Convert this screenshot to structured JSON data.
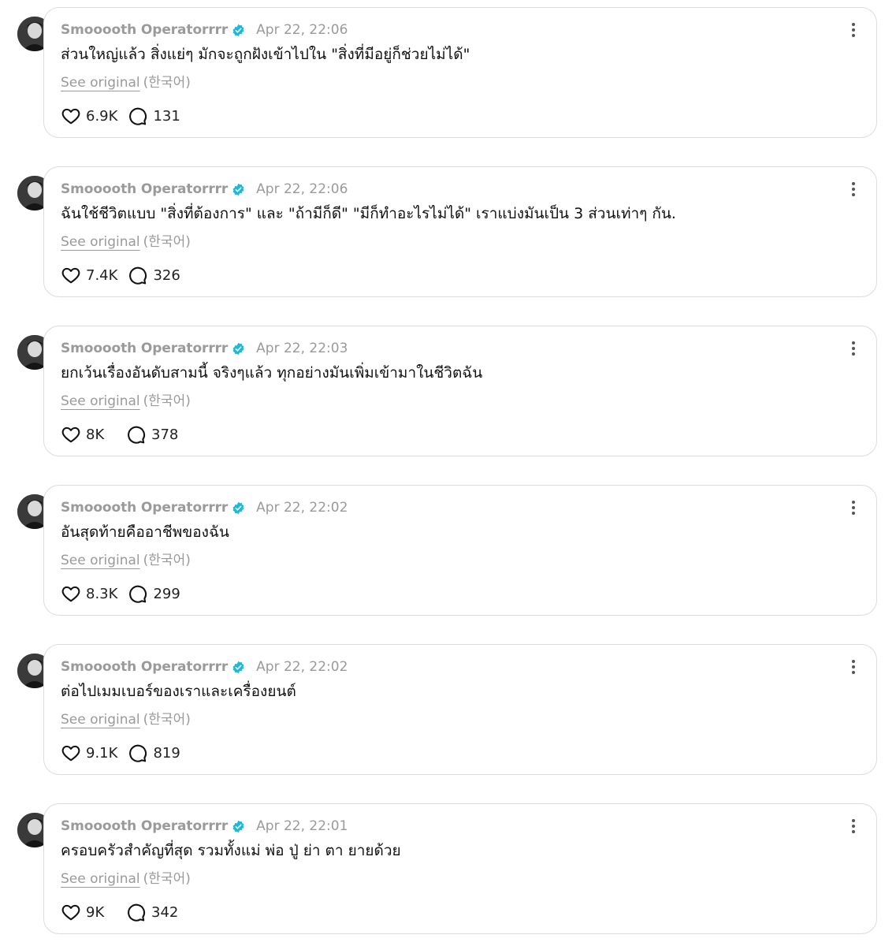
{
  "posts": [
    {
      "username": "Smooooth Operatorrrr",
      "timestamp": "Apr 22, 22:06",
      "text": "ส่วนใหญ่แล้ว สิ่งแย่ๆ มักจะถูกฝังเข้าไปใน \"สิ่งที่มีอยู่ก็ช่วยไม่ได้\"",
      "see_original": "See original",
      "language": "(한국어)",
      "likes": "6.9K",
      "replies": "131"
    },
    {
      "username": "Smooooth Operatorrrr",
      "timestamp": "Apr 22, 22:06",
      "text": "ฉันใช้ชีวิตแบบ \"สิ่งที่ต้องการ\" และ \"ถ้ามีก็ดี\" \"มีก็ทำอะไรไม่ได้\" เราแบ่งมันเป็น 3 ส่วนเท่าๆ กัน.",
      "see_original": "See original",
      "language": "(한국어)",
      "likes": "7.4K",
      "replies": "326"
    },
    {
      "username": "Smooooth Operatorrrr",
      "timestamp": "Apr 22, 22:03",
      "text": "ยกเว้นเรื่องอันดับสามนี้ จริงๆแล้ว ทุกอย่างมันเพิ่มเข้ามาในชีวิตฉัน",
      "see_original": "See original",
      "language": "(한국어)",
      "likes": "8K",
      "replies": "378"
    },
    {
      "username": "Smooooth Operatorrrr",
      "timestamp": "Apr 22, 22:02",
      "text": "อันสุดท้ายคืออาชีพของฉัน",
      "see_original": "See original",
      "language": "(한국어)",
      "likes": "8.3K",
      "replies": "299"
    },
    {
      "username": "Smooooth Operatorrrr",
      "timestamp": "Apr 22, 22:02",
      "text": "ต่อไปเมมเบอร์ของเราและเครื่องยนต์",
      "see_original": "See original",
      "language": "(한국어)",
      "likes": "9.1K",
      "replies": "819"
    },
    {
      "username": "Smooooth Operatorrrr",
      "timestamp": "Apr 22, 22:01",
      "text": "ครอบครัวสำคัญที่สุด รวมทั้งแม่ พ่อ ปู่ ย่า ตา ยายด้วย",
      "see_original": "See original",
      "language": "(한국어)",
      "likes": "9K",
      "replies": "342"
    }
  ],
  "icons": {
    "verified": "verified-badge-icon",
    "more": "more-vertical-icon",
    "like": "heart-icon",
    "reply": "comment-bubble-icon"
  },
  "colors": {
    "verified": "#1fb8d6",
    "muted_text": "#9a9a9a",
    "border": "#dcdcdc",
    "text": "#111111"
  }
}
